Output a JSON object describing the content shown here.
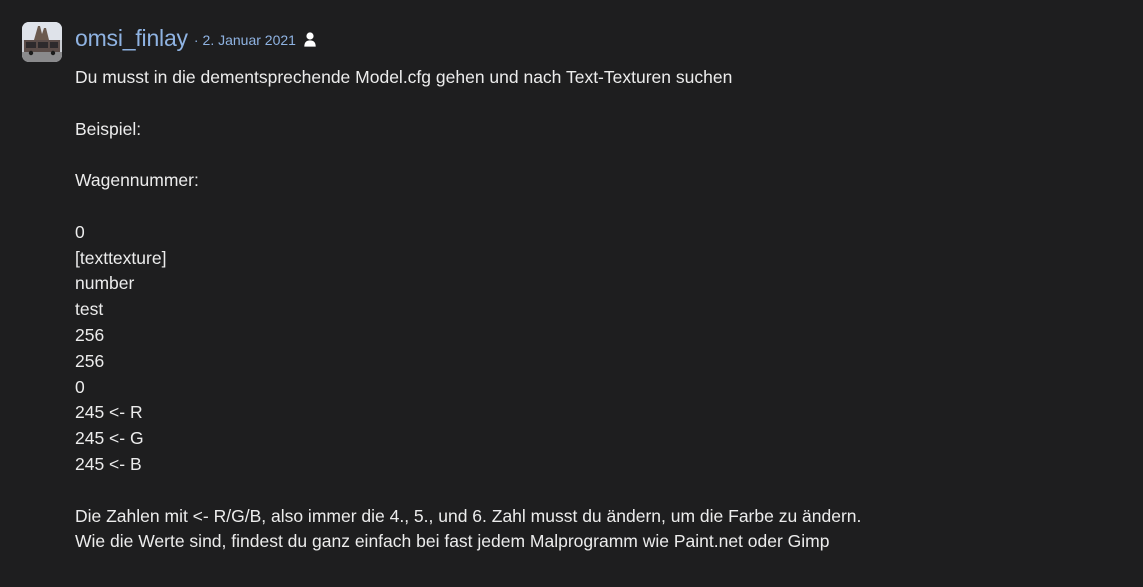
{
  "post": {
    "author": "omsi_finlay",
    "separator": "·",
    "date": "2. Januar 2021",
    "icons": {
      "avatar": "avatar-bus-photo",
      "user": "user-icon"
    },
    "colors": {
      "background": "#1e1e1f",
      "link": "#8fb3e2",
      "text": "#ececec"
    },
    "lines": [
      "Du musst in die dementsprechende Model.cfg gehen und nach Text-Texturen suchen",
      "",
      "Beispiel:",
      "",
      "Wagennummer:",
      "",
      "0",
      "[texttexture]",
      "number",
      "test",
      "256",
      "256",
      "0",
      "245 <- R",
      "245 <- G",
      "245 <- B",
      "",
      "Die Zahlen mit <- R/G/B, also immer die 4., 5., und 6. Zahl musst du ändern, um die Farbe zu ändern.",
      "Wie die Werte sind, findest du ganz einfach bei fast jedem Malprogramm wie Paint.net oder Gimp"
    ]
  }
}
